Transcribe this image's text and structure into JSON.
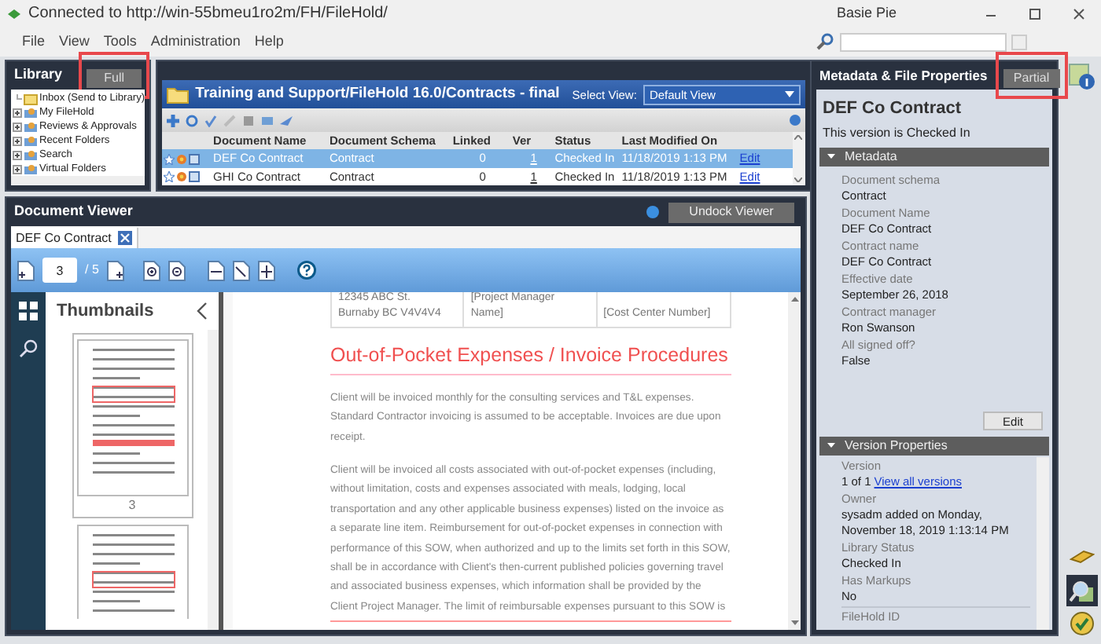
{
  "window": {
    "title": "Connected to http://win-55bmeu1ro2m/FH/FileHold/",
    "user": "Basie Pie"
  },
  "menu": [
    "File",
    "View",
    "Tools",
    "Administration",
    "Help"
  ],
  "library": {
    "title": "Library",
    "mode_button": {
      "label": "Full",
      "highlighted": true
    },
    "tree": [
      {
        "label": "Inbox (Send to Library)",
        "kind": "leaf"
      },
      {
        "label": "My FileHold",
        "kind": "branch"
      },
      {
        "label": "Reviews & Approvals",
        "kind": "branch"
      },
      {
        "label": "Recent Folders",
        "kind": "branch"
      },
      {
        "label": "Search",
        "kind": "branch"
      },
      {
        "label": "Virtual Folders",
        "kind": "branch"
      }
    ]
  },
  "documents": {
    "path": "Training and Support/FileHold 16.0/Contracts - final",
    "select_view_label": "Select View:",
    "view": "Default View",
    "columns": [
      "Document Name",
      "Document Schema",
      "Linked",
      "Ver",
      "Status",
      "Last Modified On"
    ],
    "rows": [
      {
        "selected": true,
        "cells": [
          "DEF Co Contract",
          "Contract",
          "0",
          "1",
          "Checked In",
          "11/18/2019 1:13 PM"
        ],
        "action": "Edit"
      },
      {
        "selected": false,
        "cells": [
          "GHI Co Contract",
          "Contract",
          "0",
          "1",
          "Checked In",
          "11/18/2019 1:13 PM"
        ],
        "action": "Edit"
      }
    ]
  },
  "viewer": {
    "title": "Document Viewer",
    "undock_button": "Undock Viewer",
    "tab": "DEF Co Contract",
    "page": "3",
    "page_total": "/ 5",
    "thumbnails_title": "Thumbnails",
    "thumbnail_label": "3",
    "document": {
      "address_lines": [
        "12345 ABC St.",
        "Burnaby BC V4V4V4"
      ],
      "table_cells": [
        "[Project Manager Name]",
        "[Cost Center Number]"
      ],
      "heading": "Out-of-Pocket Expenses / Invoice Procedures",
      "paragraphs": [
        "Client will be invoiced monthly for the consulting services and T&L expenses. Standard Contractor invoicing is assumed to be acceptable. Invoices are due upon receipt.",
        "Client will be invoiced all costs associated with out-of-pocket expenses (including, without limitation, costs and expenses associated with meals, lodging, local transportation and any other applicable business expenses) listed on the invoice as a separate line item. Reimbursement for out-of-pocket expenses in connection with performance of this SOW, when authorized and up to the limits set forth in this SOW, shall be in accordance with Client's then-current published policies governing travel and associated business expenses, which information shall be provided by the Client Project Manager. The limit of reimbursable expenses pursuant to this SOW is"
      ]
    }
  },
  "metadata": {
    "title": "Metadata & File Properties",
    "mode_button": {
      "label": "Partial",
      "highlighted": true
    },
    "document_title": "DEF Co Contract",
    "version_status": "This version is Checked In",
    "sections": [
      {
        "title": "Metadata",
        "expanded": true,
        "button": "Edit",
        "fields": [
          {
            "label": "Document schema",
            "value": "Contract"
          },
          {
            "label": "Document Name",
            "value": "DEF Co Contract"
          },
          {
            "label": "Contract name",
            "value": "DEF Co Contract"
          },
          {
            "label": "Effective date",
            "value": "September 26, 2018"
          },
          {
            "label": "Contract manager",
            "value": "Ron Swanson"
          },
          {
            "label": "All signed off?",
            "value": "False"
          }
        ]
      },
      {
        "title": "Version Properties",
        "expanded": true,
        "fields": [
          {
            "label": "Version",
            "value": "1 of 1",
            "link": "View all versions"
          },
          {
            "label": "Owner",
            "value": "sysadm added on Monday, November 18, 2019 1:13:14 PM"
          },
          {
            "label": "Library Status",
            "value": "Checked In"
          },
          {
            "label": "Has Markups",
            "value": "No"
          },
          {
            "label": "FileHold ID"
          }
        ]
      }
    ]
  }
}
